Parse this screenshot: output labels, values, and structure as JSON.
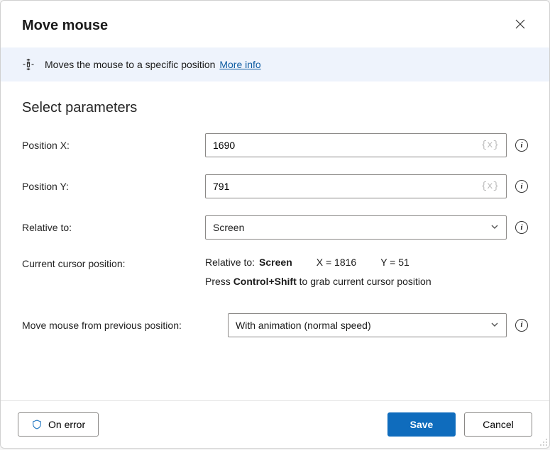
{
  "dialog": {
    "title": "Move mouse"
  },
  "banner": {
    "text": "Moves the mouse to a specific position",
    "link": "More info"
  },
  "section": {
    "title": "Select parameters"
  },
  "fields": {
    "posx": {
      "label": "Position X:",
      "value": "1690"
    },
    "posy": {
      "label": "Position Y:",
      "value": "791"
    },
    "relative": {
      "label": "Relative to:",
      "value": "Screen"
    },
    "cursor": {
      "label": "Current cursor position:",
      "rtLabel": "Relative to:",
      "rtValue": "Screen",
      "xLabel": "X =",
      "xValue": "1816",
      "yLabel": "Y =",
      "yValue": "51",
      "hintPrefix": "Press",
      "hintKeys": "Control+Shift",
      "hintSuffix": "to grab current cursor position"
    },
    "movemode": {
      "label": "Move mouse from previous position:",
      "value": "With animation (normal speed)"
    }
  },
  "buttons": {
    "onerror": "On error",
    "save": "Save",
    "cancel": "Cancel"
  },
  "glyphs": {
    "var": "{x}",
    "info": "i"
  }
}
